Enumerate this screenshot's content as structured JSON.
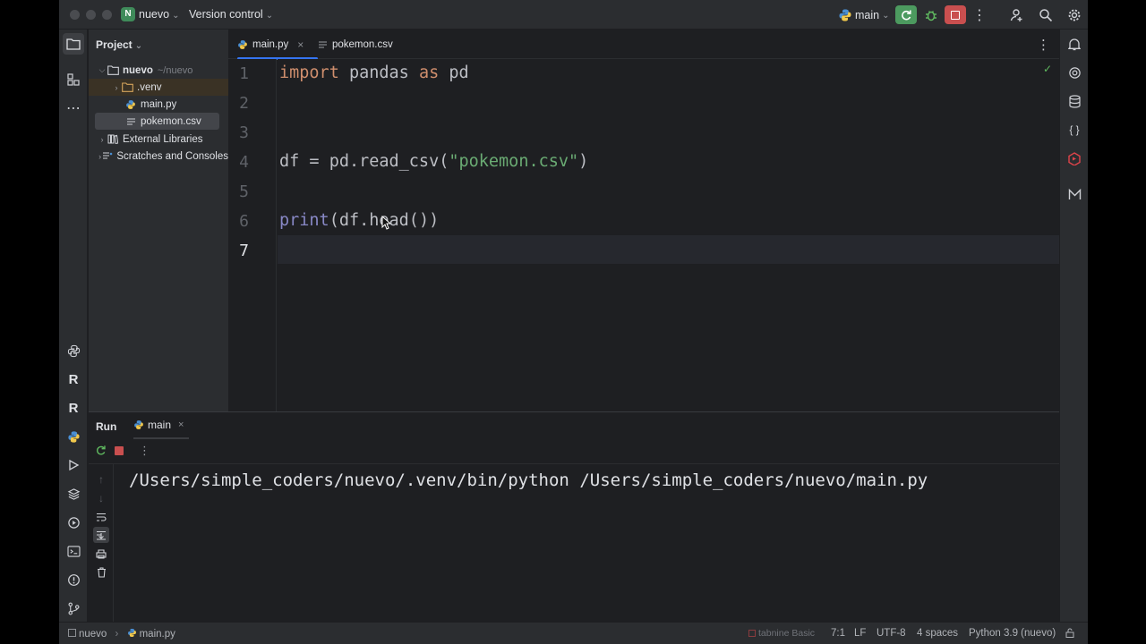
{
  "titlebar": {
    "project_initial": "N",
    "project_name": "nuevo",
    "version_control": "Version control",
    "run_config": "main"
  },
  "project_panel": {
    "title": "Project",
    "tree": [
      {
        "label": "nuevo",
        "hint": "~/nuevo",
        "level": 0,
        "expanded": true,
        "type": "root"
      },
      {
        "label": ".venv",
        "level": 1,
        "expanded": false,
        "type": "folder"
      },
      {
        "label": "main.py",
        "level": 2,
        "type": "python"
      },
      {
        "label": "pokemon.csv",
        "level": 2,
        "type": "csv",
        "selected": true
      },
      {
        "label": "External Libraries",
        "level": 0,
        "type": "libraries"
      },
      {
        "label": "Scratches and Consoles",
        "level": 0,
        "type": "scratches"
      }
    ]
  },
  "editor": {
    "tabs": [
      {
        "label": "main.py",
        "active": true
      },
      {
        "label": "pokemon.csv",
        "active": false
      }
    ],
    "line_numbers": [
      "1",
      "2",
      "3",
      "4",
      "5",
      "6",
      "7"
    ],
    "current_line": 7,
    "lines": [
      [
        {
          "t": "import",
          "c": "kw"
        },
        {
          "t": " pandas "
        },
        {
          "t": "as",
          "c": "kw"
        },
        {
          "t": " pd"
        }
      ],
      [],
      [],
      [
        {
          "t": "df = pd.read_csv("
        },
        {
          "t": "\"pokemon.csv\"",
          "c": "str"
        },
        {
          "t": ")"
        }
      ],
      [],
      [
        {
          "t": "print",
          "c": "bi"
        },
        {
          "t": "(df.head())"
        }
      ],
      []
    ]
  },
  "run_panel": {
    "title": "Run",
    "tab": "main",
    "output": "/Users/simple_coders/nuevo/.venv/bin/python /Users/simple_coders/nuevo/main.py"
  },
  "statusbar": {
    "breadcrumb_project": "nuevo",
    "breadcrumb_file": "main.py",
    "plugin": "tabnine Basic",
    "position": "7:1",
    "line_ending": "LF",
    "encoding": "UTF-8",
    "indent": "4 spaces",
    "interpreter": "Python 3.9 (nuevo)"
  },
  "colors": {
    "accent": "#3574f0",
    "run_green": "#4c9a5f",
    "stop_red": "#c94f4f",
    "keyword": "#cf8e6d",
    "string": "#6aab73",
    "builtin": "#8888c6"
  }
}
